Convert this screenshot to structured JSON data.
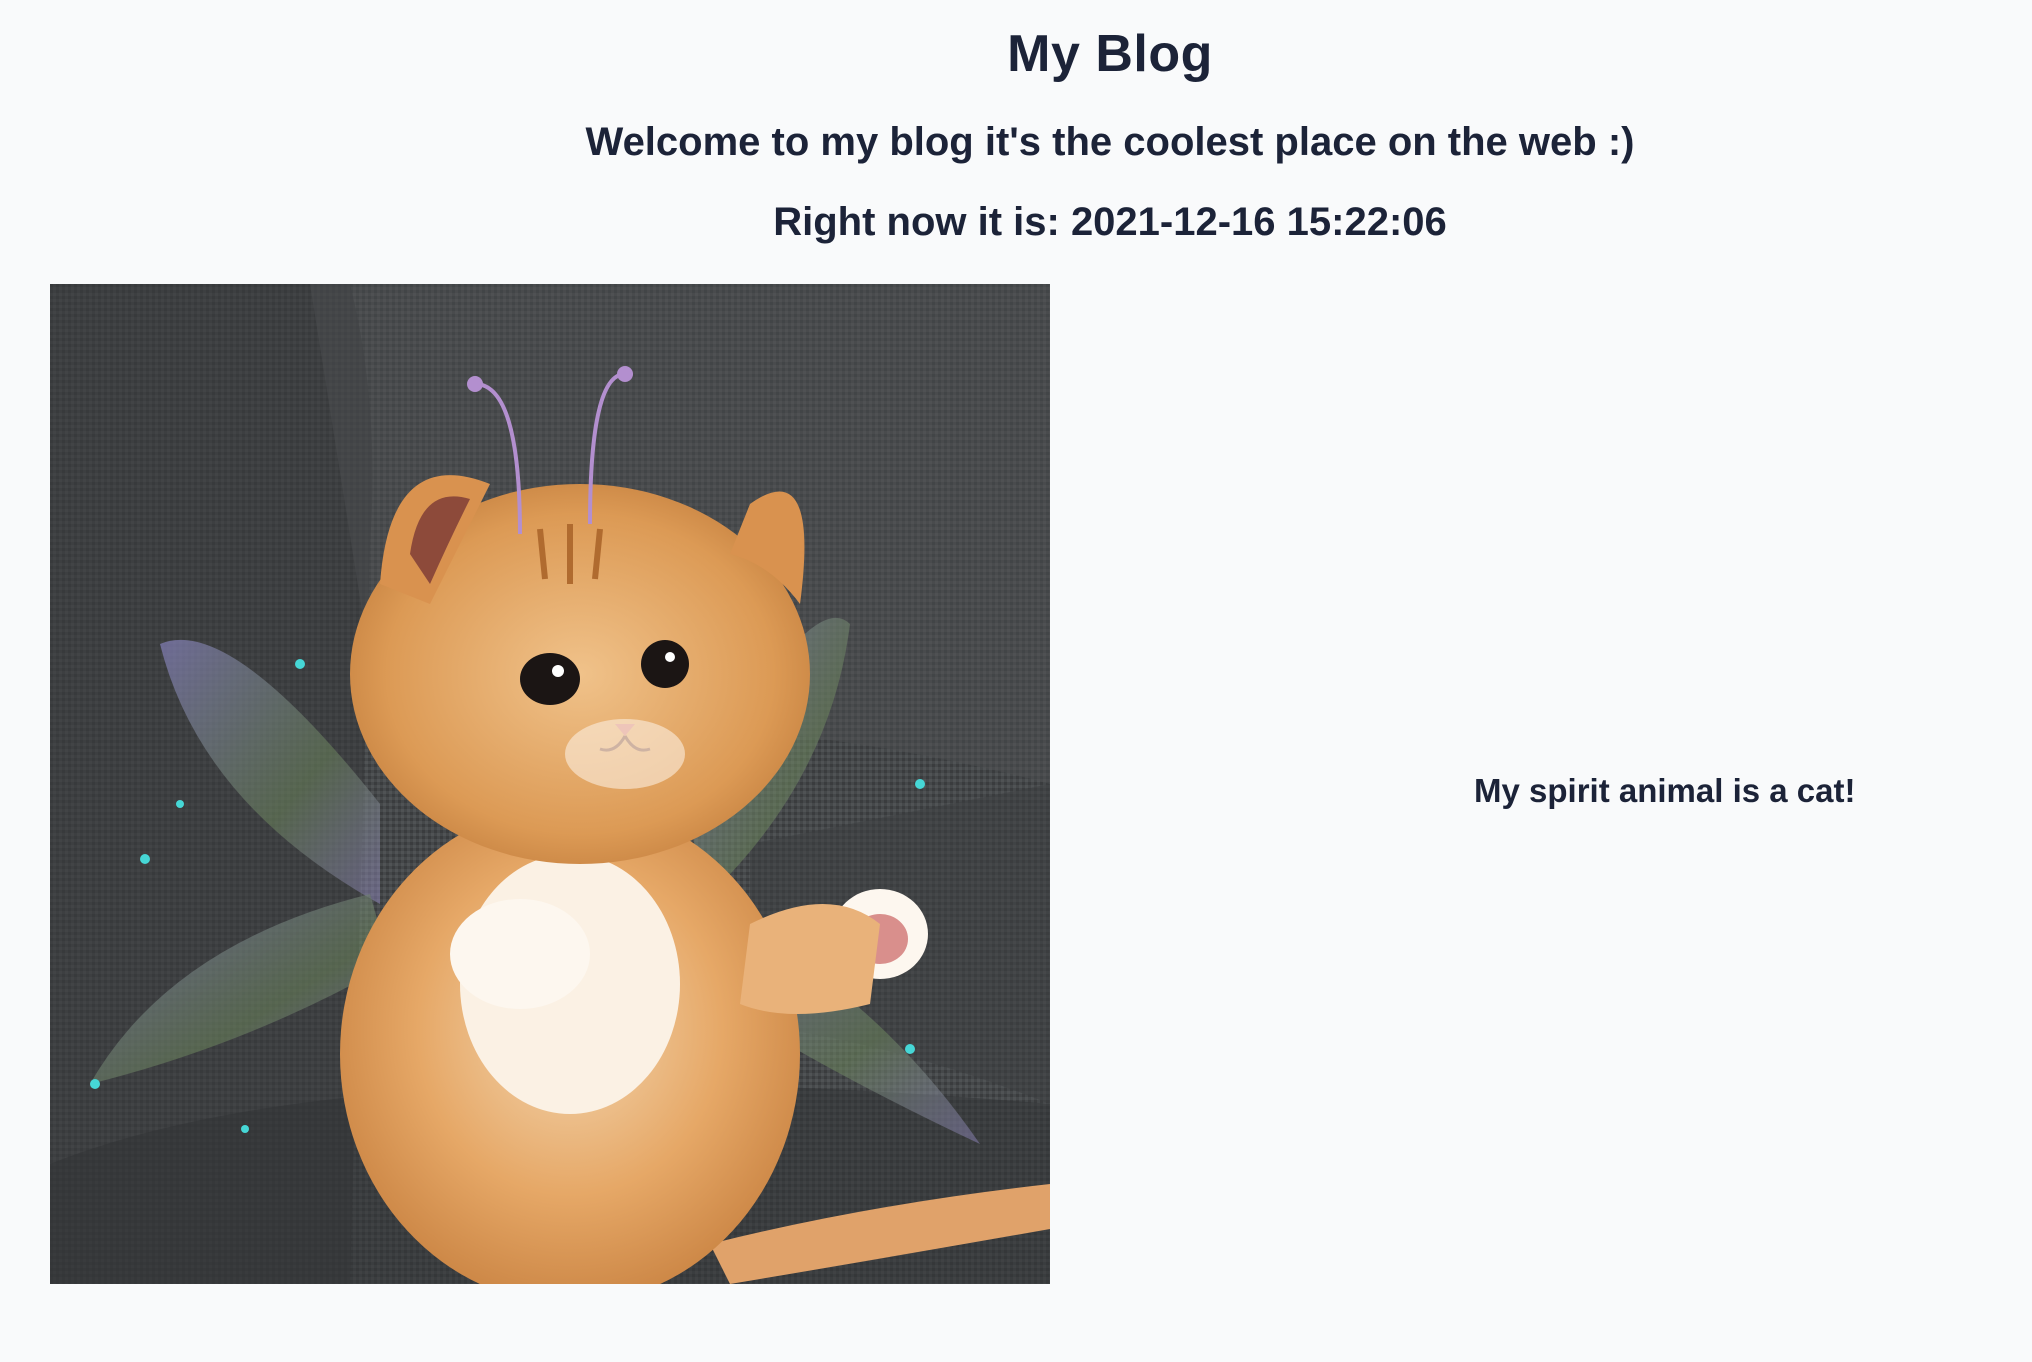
{
  "header": {
    "title": "My Blog",
    "welcome": "Welcome to my blog it's the coolest place on the web :)",
    "time_label": "Right now it is: 2021-12-16 15:22:06"
  },
  "main": {
    "image": {
      "alt": "Orange kitten with fairy wings sitting on a grey couch"
    },
    "caption": "My spirit animal is a cat!"
  }
}
